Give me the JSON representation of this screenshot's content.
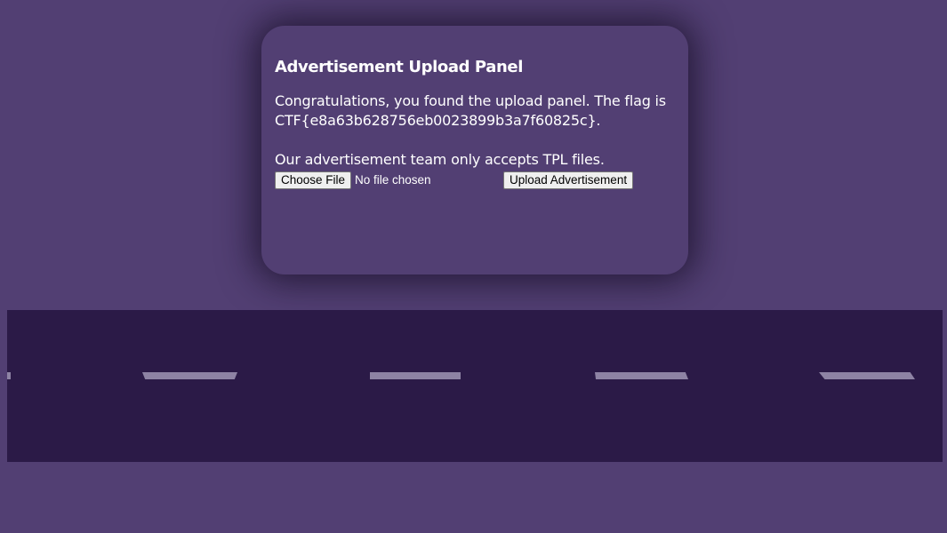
{
  "panel": {
    "title": "Advertisement Upload Panel",
    "message": "Congratulations, you found the upload panel. The flag is CTF{e8a63b628756eb0023899b3a7f60825c}.",
    "instructions": "Our advertisement team only accepts TPL files.",
    "choose_file_label": "Choose File",
    "file_status": "No file chosen",
    "upload_label": "Upload Advertisement"
  },
  "colors": {
    "background": "#523f73",
    "road": "#2b1a47",
    "lane_marking": "#8e83a4"
  }
}
